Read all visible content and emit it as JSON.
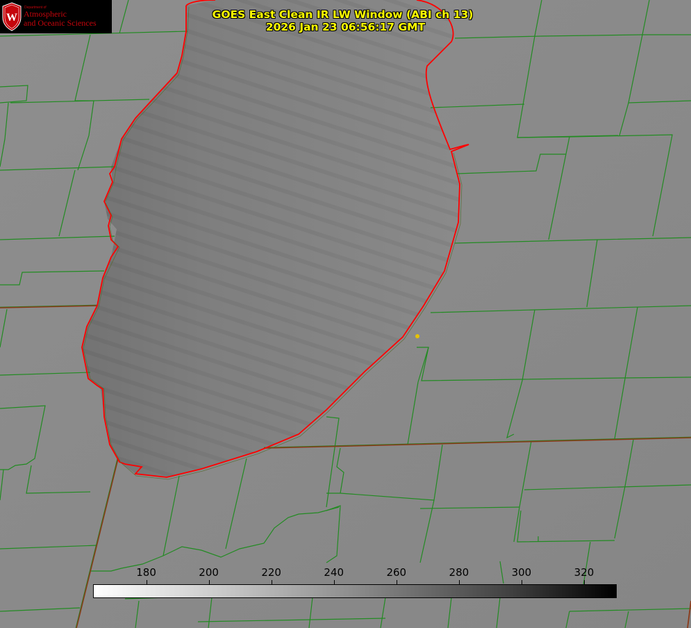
{
  "header": {
    "title_line1": "GOES East Clean IR LW Window (ABI ch 13)",
    "title_line2": "2026 Jan 23 06:56:17 GMT"
  },
  "logo": {
    "dept_label": "Department of",
    "line1": "Atmospheric",
    "line2": "and Oceanic Sciences",
    "crest_letter": "W"
  },
  "colorbar": {
    "ticks": [
      "180",
      "200",
      "220",
      "240",
      "260",
      "280",
      "300",
      "320"
    ],
    "range_min": 163,
    "range_max": 330
  },
  "colors": {
    "title": "#ffff00",
    "county_lines": "#228b22",
    "state_lines": "#8b3a1a",
    "coastline": "#ff0000",
    "station_marker": "#e6c200",
    "logo_text": "#c5050c"
  }
}
